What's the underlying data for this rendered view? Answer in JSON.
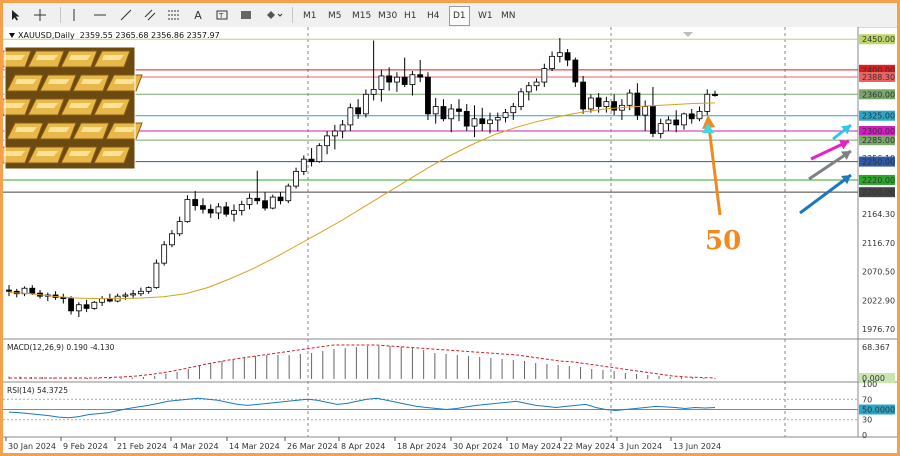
{
  "toolbar": {
    "timeframes": [
      "M1",
      "M5",
      "M15",
      "M30",
      "H1",
      "H4",
      "D1",
      "W1",
      "MN"
    ],
    "active_timeframe": "D1"
  },
  "chart_header": {
    "symbol": "XAUUSD,Daily",
    "ohlc": "2359.55 2365.68 2356.86 2357.97"
  },
  "price_axis": [
    "2450.00",
    "2400.00",
    "2388.30",
    "2360.00",
    "2325.00",
    "2300.00",
    "2285.00",
    "2256.10",
    "2250.00",
    "2220.00",
    "2200.00",
    "2164.30",
    "2116.70",
    "2070.50",
    "2022.90",
    "1976.70"
  ],
  "levels": [
    {
      "price": "2450.00",
      "color": "#bcd66a"
    },
    {
      "price": "2400.00",
      "color": "#d92020"
    },
    {
      "price": "2388.30",
      "color": "#f06060"
    },
    {
      "price": "2360.00",
      "color": "#7aa86a"
    },
    {
      "price": "2325.00",
      "color": "#2aa6c8"
    },
    {
      "price": "2300.00",
      "color": "#d01ec0"
    },
    {
      "price": "2285.00",
      "color": "#7aa86a"
    },
    {
      "price": "2250.00",
      "color": "#2e5aa8"
    },
    {
      "price": "2220.00",
      "color": "#2aa82a"
    },
    {
      "price": "2200.00",
      "color": "#444444"
    }
  ],
  "annotation": "50",
  "macd": {
    "label": "MACD(12,26,9) 0.190 -4.130",
    "axis": [
      "68.367",
      "0.000"
    ]
  },
  "rsi": {
    "label": "RSI(14) 54.3725",
    "axis": [
      "100",
      "70",
      "50.0000",
      "30",
      "0"
    ]
  },
  "date_axis": [
    "30 Jan 2024",
    "9 Feb 2024",
    "21 Feb 2024",
    "4 Mar 2024",
    "14 Mar 2024",
    "26 Mar 2024",
    "8 Apr 2024",
    "18 Apr 2024",
    "30 Apr 2024",
    "10 May 2024",
    "22 May 2024",
    "3 Jun 2024",
    "13 Jun 2024"
  ],
  "chart_data": {
    "type": "candlestick",
    "candles": [
      [
        2040,
        2048,
        2030,
        2038
      ],
      [
        2038,
        2042,
        2028,
        2034
      ],
      [
        2034,
        2046,
        2030,
        2043
      ],
      [
        2043,
        2048,
        2032,
        2035
      ],
      [
        2035,
        2040,
        2026,
        2030
      ],
      [
        2030,
        2036,
        2022,
        2032
      ],
      [
        2032,
        2038,
        2024,
        2028
      ],
      [
        2028,
        2034,
        2018,
        2026
      ],
      [
        2026,
        2030,
        2000,
        2006
      ],
      [
        2006,
        2020,
        1996,
        2016
      ],
      [
        2016,
        2024,
        2004,
        2010
      ],
      [
        2010,
        2022,
        2008,
        2020
      ],
      [
        2020,
        2030,
        2014,
        2026
      ],
      [
        2026,
        2034,
        2020,
        2022
      ],
      [
        2022,
        2034,
        2020,
        2030
      ],
      [
        2030,
        2036,
        2024,
        2032
      ],
      [
        2032,
        2040,
        2026,
        2034
      ],
      [
        2034,
        2044,
        2030,
        2038
      ],
      [
        2038,
        2046,
        2034,
        2044
      ],
      [
        2044,
        2090,
        2042,
        2084
      ],
      [
        2084,
        2120,
        2080,
        2114
      ],
      [
        2114,
        2138,
        2110,
        2132
      ],
      [
        2132,
        2160,
        2128,
        2152
      ],
      [
        2152,
        2195,
        2150,
        2188
      ],
      [
        2188,
        2202,
        2170,
        2178
      ],
      [
        2178,
        2190,
        2165,
        2172
      ],
      [
        2172,
        2180,
        2158,
        2166
      ],
      [
        2166,
        2182,
        2156,
        2176
      ],
      [
        2176,
        2184,
        2160,
        2164
      ],
      [
        2164,
        2180,
        2152,
        2170
      ],
      [
        2170,
        2186,
        2162,
        2180
      ],
      [
        2180,
        2198,
        2172,
        2190
      ],
      [
        2190,
        2235,
        2180,
        2186
      ],
      [
        2186,
        2200,
        2170,
        2174
      ],
      [
        2174,
        2196,
        2172,
        2192
      ],
      [
        2192,
        2200,
        2180,
        2186
      ],
      [
        2186,
        2214,
        2182,
        2210
      ],
      [
        2210,
        2240,
        2206,
        2234
      ],
      [
        2234,
        2260,
        2228,
        2254
      ],
      [
        2254,
        2272,
        2242,
        2250
      ],
      [
        2250,
        2280,
        2248,
        2276
      ],
      [
        2276,
        2300,
        2262,
        2292
      ],
      [
        2292,
        2310,
        2270,
        2300
      ],
      [
        2300,
        2318,
        2288,
        2310
      ],
      [
        2310,
        2345,
        2300,
        2338
      ],
      [
        2338,
        2352,
        2320,
        2328
      ],
      [
        2328,
        2368,
        2322,
        2360
      ],
      [
        2360,
        2448,
        2350,
        2368
      ],
      [
        2368,
        2400,
        2348,
        2390
      ],
      [
        2390,
        2404,
        2366,
        2380
      ],
      [
        2380,
        2396,
        2364,
        2388
      ],
      [
        2388,
        2420,
        2372,
        2376
      ],
      [
        2376,
        2398,
        2358,
        2392
      ],
      [
        2392,
        2416,
        2380,
        2388
      ],
      [
        2388,
        2396,
        2318,
        2328
      ],
      [
        2328,
        2354,
        2312,
        2340
      ],
      [
        2340,
        2352,
        2316,
        2320
      ],
      [
        2320,
        2344,
        2298,
        2336
      ],
      [
        2336,
        2352,
        2316,
        2332
      ],
      [
        2332,
        2344,
        2300,
        2308
      ],
      [
        2308,
        2342,
        2290,
        2320
      ],
      [
        2320,
        2338,
        2300,
        2312
      ],
      [
        2312,
        2330,
        2296,
        2318
      ],
      [
        2318,
        2330,
        2300,
        2322
      ],
      [
        2322,
        2336,
        2314,
        2330
      ],
      [
        2330,
        2346,
        2318,
        2340
      ],
      [
        2340,
        2370,
        2334,
        2364
      ],
      [
        2364,
        2380,
        2350,
        2374
      ],
      [
        2374,
        2386,
        2366,
        2380
      ],
      [
        2380,
        2410,
        2372,
        2402
      ],
      [
        2402,
        2430,
        2398,
        2422
      ],
      [
        2422,
        2452,
        2412,
        2428
      ],
      [
        2428,
        2434,
        2406,
        2416
      ],
      [
        2416,
        2420,
        2372,
        2380
      ],
      [
        2380,
        2390,
        2328,
        2336
      ],
      [
        2336,
        2360,
        2330,
        2354
      ],
      [
        2354,
        2362,
        2330,
        2340
      ],
      [
        2340,
        2356,
        2330,
        2348
      ],
      [
        2348,
        2360,
        2326,
        2334
      ],
      [
        2334,
        2352,
        2318,
        2342
      ],
      [
        2342,
        2368,
        2334,
        2362
      ],
      [
        2362,
        2378,
        2318,
        2326
      ],
      [
        2326,
        2350,
        2300,
        2340
      ],
      [
        2340,
        2372,
        2290,
        2296
      ],
      [
        2296,
        2320,
        2288,
        2312
      ],
      [
        2312,
        2324,
        2300,
        2318
      ],
      [
        2318,
        2334,
        2298,
        2310
      ],
      [
        2310,
        2330,
        2302,
        2328
      ],
      [
        2328,
        2336,
        2312,
        2320
      ],
      [
        2320,
        2340,
        2316,
        2332
      ],
      [
        2332,
        2368,
        2326,
        2360
      ],
      [
        2360,
        2366,
        2356,
        2358
      ]
    ],
    "ma_values": [
      2036,
      2034,
      2030,
      2027,
      2026,
      2026,
      2027,
      2029,
      2034,
      2044,
      2058,
      2074,
      2092,
      2112,
      2132,
      2152,
      2174,
      2196,
      2218,
      2240,
      2260,
      2278,
      2294,
      2306,
      2316,
      2324,
      2331,
      2336,
      2339,
      2341,
      2343,
      2345,
      2346
    ],
    "macd_hist": [
      5,
      5,
      4,
      4,
      3,
      3,
      2,
      2,
      2,
      2,
      2,
      3,
      4,
      6,
      10,
      14,
      20,
      26,
      32,
      36,
      40,
      44,
      46,
      48,
      48,
      48,
      50,
      52,
      56,
      60,
      62,
      64,
      66,
      66,
      66,
      64,
      62,
      58,
      52,
      50,
      48,
      46,
      44,
      42,
      40,
      38,
      36,
      32,
      30,
      28,
      26,
      24,
      20,
      18,
      16,
      12,
      10,
      8,
      6,
      4,
      4,
      3,
      2,
      2
    ],
    "macd_signal": [
      2,
      2,
      2,
      2,
      2,
      2,
      2,
      3,
      4,
      6,
      9,
      13,
      18,
      24,
      30,
      35,
      40,
      44,
      48,
      52,
      56,
      60,
      64,
      68,
      68,
      68,
      68,
      66,
      64,
      62,
      60,
      58,
      56,
      54,
      52,
      50,
      48,
      44,
      40,
      36,
      34,
      30,
      26,
      22,
      18,
      14,
      10,
      6,
      4,
      3,
      2
    ],
    "rsi": [
      45,
      44,
      42,
      40,
      38,
      35,
      34,
      36,
      40,
      42,
      44,
      48,
      52,
      55,
      58,
      62,
      66,
      68,
      70,
      72,
      70,
      68,
      64,
      60,
      58,
      60,
      62,
      64,
      66,
      68,
      70,
      68,
      64,
      60,
      62,
      66,
      70,
      72,
      68,
      64,
      60,
      56,
      54,
      52,
      50,
      52,
      55,
      58,
      60,
      62,
      64,
      66,
      62,
      58,
      56,
      54,
      56,
      58,
      60,
      54,
      50,
      48,
      50,
      52,
      54,
      56,
      55,
      54,
      52,
      54,
      53,
      54
    ]
  }
}
